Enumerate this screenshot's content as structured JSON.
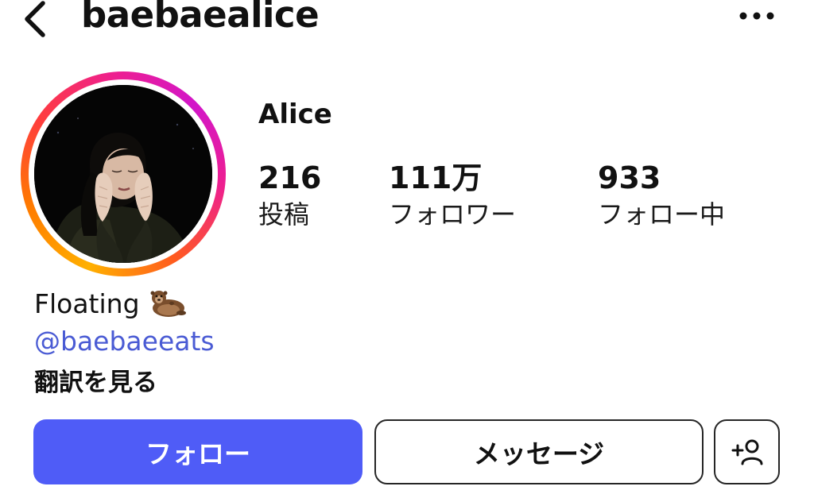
{
  "header": {
    "username": "baebaealice",
    "back_icon": "chevron-left-icon",
    "more_icon": "more-horizontal-icon"
  },
  "profile": {
    "display_name": "Alice",
    "avatar_ring_colors": [
      "#ffb000",
      "#ff7a00",
      "#ee1f8f",
      "#d216c9"
    ]
  },
  "stats": [
    {
      "value": "216",
      "label": "投稿"
    },
    {
      "value": "111万",
      "label": "フォロワー"
    },
    {
      "value": "933",
      "label": "フォロー中"
    }
  ],
  "bio": {
    "text": "Floating",
    "emoji_icon": "otter-emoji-icon",
    "link": "@baebaeeats",
    "link_color": "#4a5bd4",
    "see_translation": "翻訳を見る"
  },
  "actions": {
    "follow_label": "フォロー",
    "follow_color": "#4f5cf7",
    "message_label": "メッセージ",
    "add_user_icon": "add-user-icon"
  }
}
